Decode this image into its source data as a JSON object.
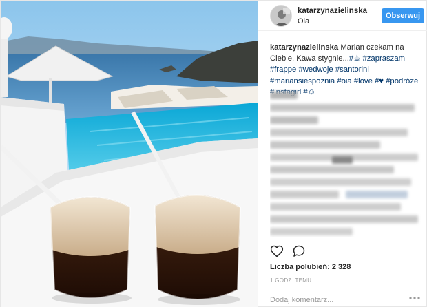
{
  "post": {
    "username": "katarzynazielinska",
    "location": "Oia",
    "follow_label": "Obserwuj"
  },
  "caption": {
    "username": "katarzynazielinska",
    "text_1": "Marian czekam na Ciebie. Kawa stygnie...",
    "tag_1": "#☕",
    "tag_2": "#zapraszam",
    "tag_3": "#frappe",
    "tag_4": "#wedwoje",
    "tag_5": "#santorini",
    "tag_6": "#mariansiespoznia",
    "tag_7": "#oia",
    "tag_8": "#love",
    "tag_9": "#♥",
    "tag_10": "#podróże",
    "tag_11": "#instagirl",
    "tag_12": "#☺"
  },
  "actions": {
    "like_icon": "heart-icon",
    "comment_icon": "speech-bubble-icon"
  },
  "likes": {
    "label": "Liczba polubień:",
    "count": "2 328"
  },
  "time": {
    "text": "1 GODZ. TEMU"
  },
  "comment_box": {
    "placeholder": "Dodaj komentarz...",
    "more_icon": "ellipsis-icon"
  },
  "colors": {
    "follow_button": "#3897f0",
    "hashtag": "#003569",
    "muted_text": "#999999"
  }
}
